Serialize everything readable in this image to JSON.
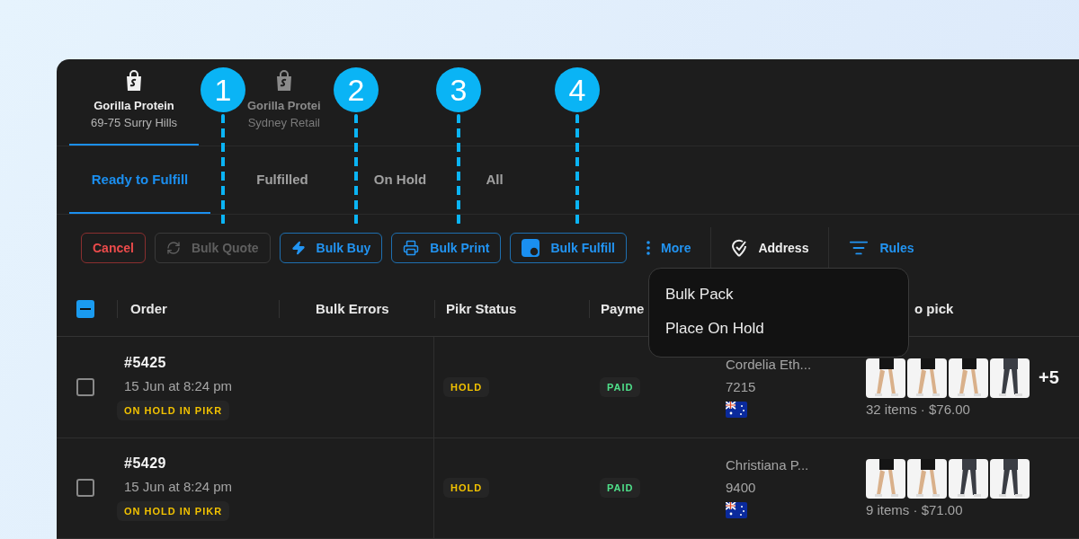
{
  "stores": [
    {
      "name": "Gorilla Protein",
      "location": "69-75 Surry Hills",
      "selected": true
    },
    {
      "name": "Gorilla Protei",
      "location": "Sydney Retail",
      "selected": false
    }
  ],
  "tabs": [
    {
      "label": "Ready to Fulfill",
      "selected": true
    },
    {
      "label": "Fulfilled",
      "selected": false
    },
    {
      "label": "On Hold",
      "selected": false
    },
    {
      "label": "All",
      "selected": false
    }
  ],
  "toolbar": [
    {
      "label": "Cancel",
      "kind": "danger",
      "disabled": false
    },
    {
      "label": "Bulk Quote",
      "kind": "outline",
      "disabled": true
    },
    {
      "label": "Bulk Buy",
      "kind": "outline",
      "disabled": false
    },
    {
      "label": "Bulk Print",
      "kind": "outline",
      "disabled": false
    },
    {
      "label": "Bulk Fulfill",
      "kind": "outline",
      "disabled": false
    },
    {
      "label": "More",
      "kind": "text",
      "disabled": false
    },
    {
      "label": "Address",
      "kind": "plain",
      "disabled": false
    },
    {
      "label": "Rules",
      "kind": "text",
      "disabled": false
    }
  ],
  "menu": {
    "items": [
      "Bulk Pack",
      "Place On Hold"
    ]
  },
  "header_checkbox": {
    "indeterminate": true
  },
  "columns": [
    "Order",
    "Bulk Errors",
    "Pikr Status",
    "Payme",
    "o pick"
  ],
  "rows": [
    {
      "checked": false,
      "order": "#5425",
      "date": "15 Jun at 8:24 pm",
      "badge": "ON HOLD IN PIKR",
      "pikr_status": "HOLD",
      "payment": "PAID",
      "customer": "Cordelia Eth...",
      "postcode": "7215",
      "extra": "+5",
      "summary": "32 items · $76.00"
    },
    {
      "checked": false,
      "order": "#5429",
      "date": "15 Jun at 8:24 pm",
      "badge": "ON HOLD IN PIKR",
      "pikr_status": "HOLD",
      "payment": "PAID",
      "customer": "Christiana P...",
      "postcode": "9400",
      "summary": "9 items · $71.00"
    }
  ],
  "markers": [
    "1",
    "2",
    "3",
    "4"
  ]
}
